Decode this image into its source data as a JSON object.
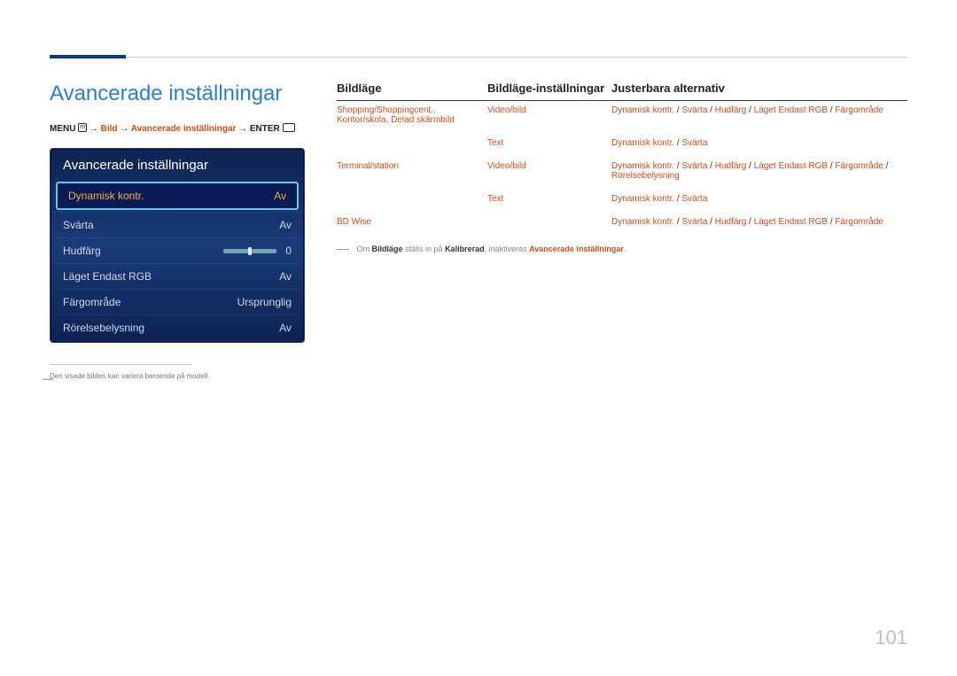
{
  "page_title": "Avancerade inställningar",
  "breadcrumb": {
    "prefix": "MENU",
    "menu_icon": "m",
    "arrow": "→",
    "step1": "Bild",
    "step2": "Avancerade inställningar",
    "suffix": "ENTER"
  },
  "menu": {
    "title": "Avancerade inställningar",
    "items": [
      {
        "label": "Dynamisk kontr.",
        "value": "Av",
        "selected": true
      },
      {
        "label": "Svärta",
        "value": "Av"
      },
      {
        "label": "Hudfärg",
        "value": "0",
        "slider": true
      },
      {
        "label": "Läget Endast RGB",
        "value": "Av"
      },
      {
        "label": "Färgområde",
        "value": "Ursprunglig"
      },
      {
        "label": "Rörelsebelysning",
        "value": "Av"
      }
    ]
  },
  "left_footnote": "Den visade bilden kan variera beroende på modell.",
  "table": {
    "headers": {
      "c1": "Bildläge",
      "c2": "Bildläge-inställningar",
      "c3": "Justerbara alternativ"
    },
    "rows": [
      {
        "c1_lines": [
          "Shopping/Shoppingcent.,",
          "Kontor/skola, Delad skärmbild"
        ],
        "c2": "Video/bild",
        "c3_parts": [
          "Dynamisk kontr.",
          " / ",
          "Svärta",
          " / ",
          "Hudfärg",
          " / ",
          "Läget Endast RGB",
          " / ",
          "Färgområde"
        ]
      },
      {
        "c1_lines": [
          ""
        ],
        "c2": "Text",
        "c3_parts": [
          "Dynamisk kontr.",
          " / ",
          "Svärta"
        ]
      },
      {
        "c1_lines": [
          "Terminal/station"
        ],
        "c2": "Video/bild",
        "c3_parts": [
          "Dynamisk kontr.",
          " / ",
          "Svärta",
          " / ",
          "Hudfärg",
          " / ",
          "Läget Endast RGB",
          " / ",
          "Färgområde",
          " / ",
          "Rörelsebelysning"
        ]
      },
      {
        "c1_lines": [
          ""
        ],
        "c2": "Text",
        "c3_parts": [
          "Dynamisk kontr.",
          " / ",
          "Svärta"
        ]
      },
      {
        "c1_lines": [
          "BD Wise"
        ],
        "c2": "",
        "c3_parts": [
          "Dynamisk kontr.",
          " / ",
          "Svärta",
          " / ",
          "Hudfärg",
          " / ",
          "Läget Endast RGB",
          " / ",
          "Färgområde"
        ]
      }
    ]
  },
  "right_note": {
    "pre": "Om ",
    "b1": "Bildläge",
    "mid1": " ställs in på ",
    "b2": "Kalibrerad",
    "mid2": ", inaktiveras ",
    "b3": "Avancerade inställningar",
    "post": "."
  },
  "page_number": "101"
}
